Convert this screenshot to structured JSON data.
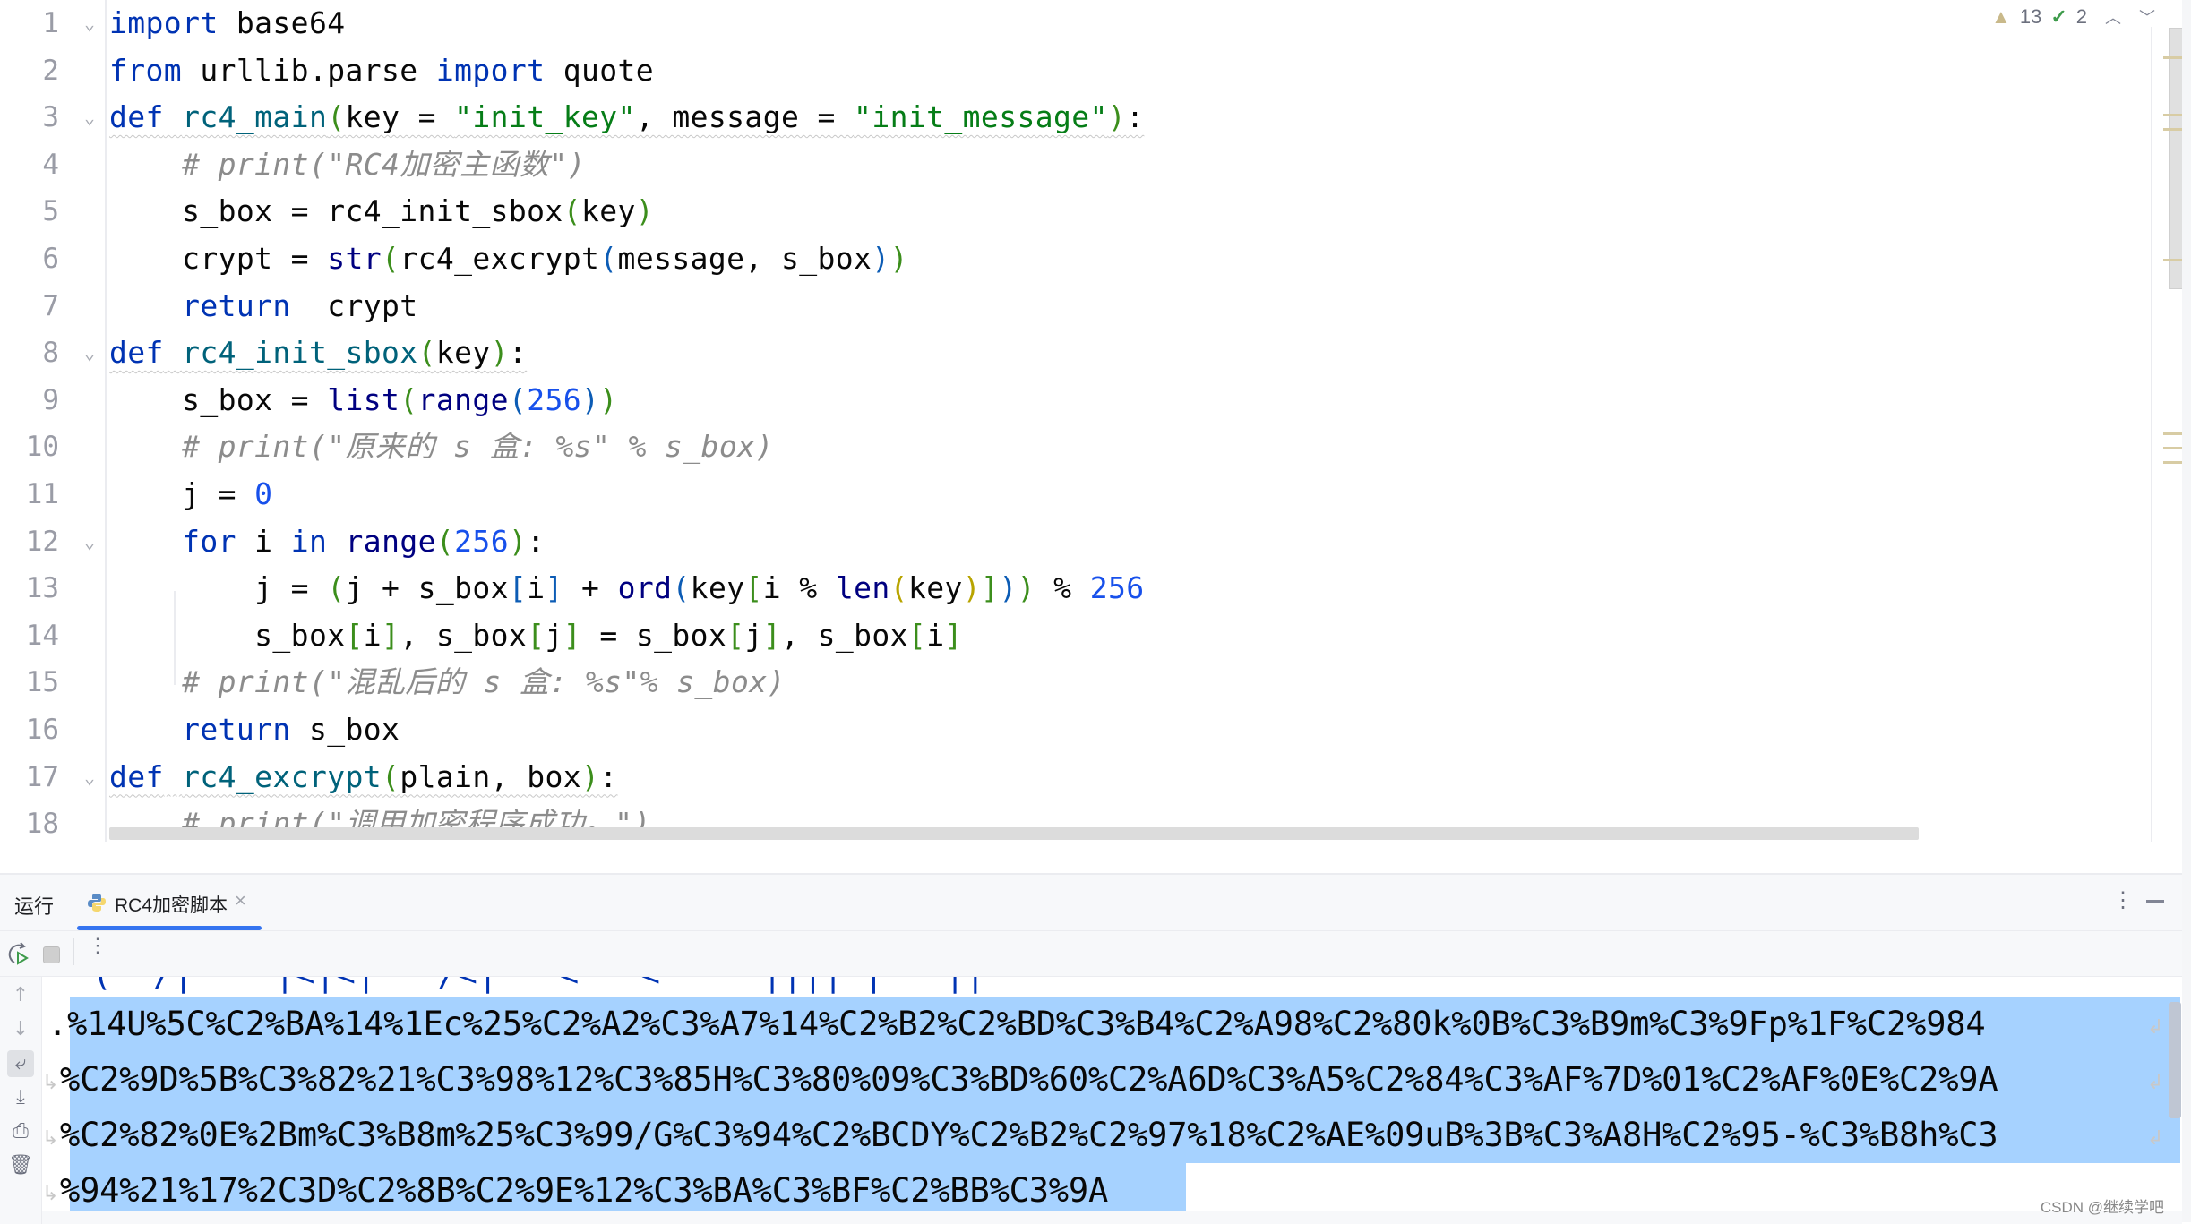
{
  "editor": {
    "line_numbers": [
      "1",
      "2",
      "3",
      "4",
      "5",
      "6",
      "7",
      "8",
      "9",
      "10",
      "11",
      "12",
      "13",
      "14",
      "15",
      "16",
      "17",
      "18"
    ],
    "lines": [
      [
        {
          "t": "import",
          "c": "kw"
        },
        {
          "t": " base64",
          "c": ""
        }
      ],
      [
        {
          "t": "from",
          "c": "kw"
        },
        {
          "t": " urllib.parse ",
          "c": ""
        },
        {
          "t": "import",
          "c": "kw"
        },
        {
          "t": " quote",
          "c": ""
        }
      ],
      [
        {
          "t": "def",
          "c": "kw"
        },
        {
          "t": " ",
          "c": ""
        },
        {
          "t": "rc4_main",
          "c": "fn"
        },
        {
          "t": "(",
          "c": "p1"
        },
        {
          "t": "key = ",
          "c": ""
        },
        {
          "t": "\"init_key\"",
          "c": "st"
        },
        {
          "t": ", message = ",
          "c": ""
        },
        {
          "t": "\"init_message\"",
          "c": "st"
        },
        {
          "t": ")",
          "c": "p1"
        },
        {
          "t": ":",
          "c": ""
        }
      ],
      [
        {
          "t": "    # print(\"RC4加密主函数\")",
          "c": "cm"
        }
      ],
      [
        {
          "t": "    s_box = rc4_init_sbox",
          "c": ""
        },
        {
          "t": "(",
          "c": "p1"
        },
        {
          "t": "key",
          "c": ""
        },
        {
          "t": ")",
          "c": "p1"
        }
      ],
      [
        {
          "t": "    crypt = ",
          "c": ""
        },
        {
          "t": "str",
          "c": "bi"
        },
        {
          "t": "(",
          "c": "p1"
        },
        {
          "t": "rc4_excrypt",
          "c": ""
        },
        {
          "t": "(",
          "c": "p2"
        },
        {
          "t": "message, s_box",
          "c": ""
        },
        {
          "t": ")",
          "c": "p2"
        },
        {
          "t": ")",
          "c": "p1"
        }
      ],
      [
        {
          "t": "    ",
          "c": ""
        },
        {
          "t": "return",
          "c": "kw"
        },
        {
          "t": "  crypt",
          "c": ""
        }
      ],
      [
        {
          "t": "def",
          "c": "kw"
        },
        {
          "t": " ",
          "c": ""
        },
        {
          "t": "rc4_init_sbox",
          "c": "fn"
        },
        {
          "t": "(",
          "c": "p1"
        },
        {
          "t": "key",
          "c": ""
        },
        {
          "t": ")",
          "c": "p1"
        },
        {
          "t": ":",
          "c": ""
        }
      ],
      [
        {
          "t": "    s_box = ",
          "c": ""
        },
        {
          "t": "list",
          "c": "bi"
        },
        {
          "t": "(",
          "c": "p1"
        },
        {
          "t": "range",
          "c": "bi"
        },
        {
          "t": "(",
          "c": "p2"
        },
        {
          "t": "256",
          "c": "nm"
        },
        {
          "t": ")",
          "c": "p2"
        },
        {
          "t": ")",
          "c": "p1"
        }
      ],
      [
        {
          "t": "    # print(\"原来的 s 盒: %s\" % s_box)",
          "c": "cm"
        }
      ],
      [
        {
          "t": "    j = ",
          "c": ""
        },
        {
          "t": "0",
          "c": "nm"
        }
      ],
      [
        {
          "t": "    ",
          "c": ""
        },
        {
          "t": "for",
          "c": "kw"
        },
        {
          "t": " i ",
          "c": ""
        },
        {
          "t": "in",
          "c": "kw"
        },
        {
          "t": " ",
          "c": ""
        },
        {
          "t": "range",
          "c": "bi"
        },
        {
          "t": "(",
          "c": "p1"
        },
        {
          "t": "256",
          "c": "nm"
        },
        {
          "t": ")",
          "c": "p1"
        },
        {
          "t": ":",
          "c": ""
        }
      ],
      [
        {
          "t": "        j = ",
          "c": ""
        },
        {
          "t": "(",
          "c": "p1"
        },
        {
          "t": "j + s_box",
          "c": ""
        },
        {
          "t": "[",
          "c": "p2"
        },
        {
          "t": "i",
          "c": ""
        },
        {
          "t": "]",
          "c": "p2"
        },
        {
          "t": " + ",
          "c": ""
        },
        {
          "t": "ord",
          "c": "bi"
        },
        {
          "t": "(",
          "c": "p2"
        },
        {
          "t": "key",
          "c": ""
        },
        {
          "t": "[",
          "c": "p1"
        },
        {
          "t": "i % ",
          "c": ""
        },
        {
          "t": "len",
          "c": "bi"
        },
        {
          "t": "(",
          "c": "p3"
        },
        {
          "t": "key",
          "c": ""
        },
        {
          "t": ")",
          "c": "p3"
        },
        {
          "t": "]",
          "c": "p1"
        },
        {
          "t": ")",
          "c": "p2"
        },
        {
          "t": ")",
          "c": "p1"
        },
        {
          "t": " % ",
          "c": ""
        },
        {
          "t": "256",
          "c": "nm"
        }
      ],
      [
        {
          "t": "        s_box",
          "c": ""
        },
        {
          "t": "[",
          "c": "p1"
        },
        {
          "t": "i",
          "c": ""
        },
        {
          "t": "]",
          "c": "p1"
        },
        {
          "t": ", s_box",
          "c": ""
        },
        {
          "t": "[",
          "c": "p1"
        },
        {
          "t": "j",
          "c": ""
        },
        {
          "t": "]",
          "c": "p1"
        },
        {
          "t": " = s_box",
          "c": ""
        },
        {
          "t": "[",
          "c": "p1"
        },
        {
          "t": "j",
          "c": ""
        },
        {
          "t": "]",
          "c": "p1"
        },
        {
          "t": ", s_box",
          "c": ""
        },
        {
          "t": "[",
          "c": "p1"
        },
        {
          "t": "i",
          "c": ""
        },
        {
          "t": "]",
          "c": "p1"
        }
      ],
      [
        {
          "t": "    # print(\"混乱后的 s 盒: %s\"% s_box)",
          "c": "cm"
        }
      ],
      [
        {
          "t": "    ",
          "c": ""
        },
        {
          "t": "return",
          "c": "kw"
        },
        {
          "t": " s_box",
          "c": ""
        }
      ],
      [
        {
          "t": "def",
          "c": "kw"
        },
        {
          "t": " ",
          "c": ""
        },
        {
          "t": "rc4_excrypt",
          "c": "fn"
        },
        {
          "t": "(",
          "c": "p1"
        },
        {
          "t": "plain, box",
          "c": ""
        },
        {
          "t": ")",
          "c": "p1"
        },
        {
          "t": ":",
          "c": ""
        }
      ],
      [
        {
          "t": "    # print(\"调用加密程序成功。\")",
          "c": "cm"
        }
      ]
    ],
    "foldable_lines": [
      1,
      3,
      8,
      12,
      17
    ],
    "wavy_lines": [
      3,
      8,
      17
    ],
    "inspections": {
      "warnings": "13",
      "weak_warnings": "2"
    }
  },
  "run_panel": {
    "title": "运行",
    "tab_label": "RC4加密脚本",
    "output_lines": [
      ".%14U%5C%C2%BA%14%1Ec%25%C2%A2%C3%A7%14%C2%B2%C2%BD%C3%B4%C2%A98%C2%80k%0B%C3%B9m%C3%9Fp%1F%C2%984",
      "%C2%9D%5B%C3%82%21%C3%98%12%C3%85H%C3%80%09%C3%BD%60%C2%A6D%C3%A5%C2%84%C3%AF%7D%01%C2%AF%0E%C2%9A",
      "%C2%82%0E%2Bm%C3%B8m%25%C3%99/G%C3%94%C2%BCDY%C2%B2%C2%97%18%C2%AE%09uB%3B%C3%A8H%C2%95-%C3%B8h%C3",
      "%94%21%17%2C3D%C2%8B%C2%9E%12%C3%BA%C3%BF%C2%BB%C3%9A"
    ],
    "side_tools": [
      "up-arrow-icon",
      "down-arrow-icon",
      "soft-wrap-icon",
      "scroll-to-end-icon",
      "print-icon",
      "trash-icon"
    ]
  },
  "watermark": "CSDN @继续学吧",
  "colors": {
    "selection": "#a6d2ff",
    "accent": "#3574f0",
    "keyword": "#0033b3",
    "string": "#067d17"
  }
}
